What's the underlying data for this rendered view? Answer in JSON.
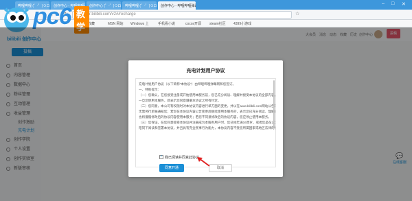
{
  "browser": {
    "tabs": [
      {
        "label": "哔哩哔哩 (゜-゜)つロ 干杯"
      },
      {
        "label": "创作中心 - 哔哩哔哩弹幕视频"
      },
      {
        "label": "创作中心 (゜-゜)つロ 干杯~"
      },
      {
        "label": "哔哩哔哩 (゜-゜)つロ 干杯"
      },
      {
        "label": "创作中心 - 哔哩哔哩弹幕视"
      }
    ],
    "address": "member.bilibili.com/v2#/recharge",
    "bookmarks": [
      {
        "label": "收藏"
      },
      {
        "label": "MSN 网站"
      },
      {
        "label": "Windows 上"
      },
      {
        "label": "手机看小说"
      },
      {
        "label": "cocos开源"
      },
      {
        "label": "steam社区"
      },
      {
        "label": "4399小游戏"
      }
    ]
  },
  "watermark": {
    "logo": "pc6",
    "edu": "教学"
  },
  "sidebar": {
    "brand": "bilibili 创作中心",
    "upload": "投稿",
    "items": [
      {
        "label": "首页"
      },
      {
        "label": "内容管理"
      },
      {
        "label": "数据中心"
      },
      {
        "label": "粉丝管理"
      },
      {
        "label": "互动管理"
      },
      {
        "label": "收益管理"
      },
      {
        "label": "创作激励"
      },
      {
        "label": "充电计划"
      },
      {
        "label": "创作学院"
      },
      {
        "label": "个人设置"
      },
      {
        "label": "创作实验室"
      },
      {
        "label": "新版审核"
      }
    ]
  },
  "header": {
    "links": [
      "大会员",
      "消息",
      "动态",
      "收藏",
      "历史",
      "创作中心"
    ],
    "submit": "投稿"
  },
  "chat_widget": {
    "label": "在线客服"
  },
  "dialog": {
    "title": "充电计划用户协议",
    "lines": [
      "充电计划用户协议（以下简称\"本协议\"）由哔哩哔哩弹幕网和您签订。",
      "一、特别提示：",
      "（一）您确认，在您接受注册或开始使用本服务前，您已充分阅读、理解并接受本协议的全部内容，",
      "一旦您使用本服务，即表示您同意遵循本协议之所有约定。",
      "（二）您同意，本公司有权随时对本协议内容进行单方面的变更，并以在www.bilibili.com网站公告的方式予以公布，",
      "无需另行单独通知您；若您在本协议内容公告变更后继续使用本服务的，表示您已充分阅读、理解并接受修改后的协议内容，",
      "也将遵循修改后的协议内容使用本服务；若您不同意修改后的协议内容，您应停止使用本服务。",
      "（三）您保证，在您同意接受本协议并注册成为本服务用户时，您已经年满16周岁，或者您是在法定监护人",
      "陪同下阅读和签署本协议，并且具有完全民事行为能力，本协议内容不受您所属国家或地区法律的排斥。"
    ],
    "agree_label": "我已阅读并同意此协议",
    "confirm": "同意开通",
    "cancel": "取消"
  },
  "colors": {
    "primary": "#1b8fd6",
    "accent": "#e5576c",
    "tab_bar": "#3d97dc"
  }
}
